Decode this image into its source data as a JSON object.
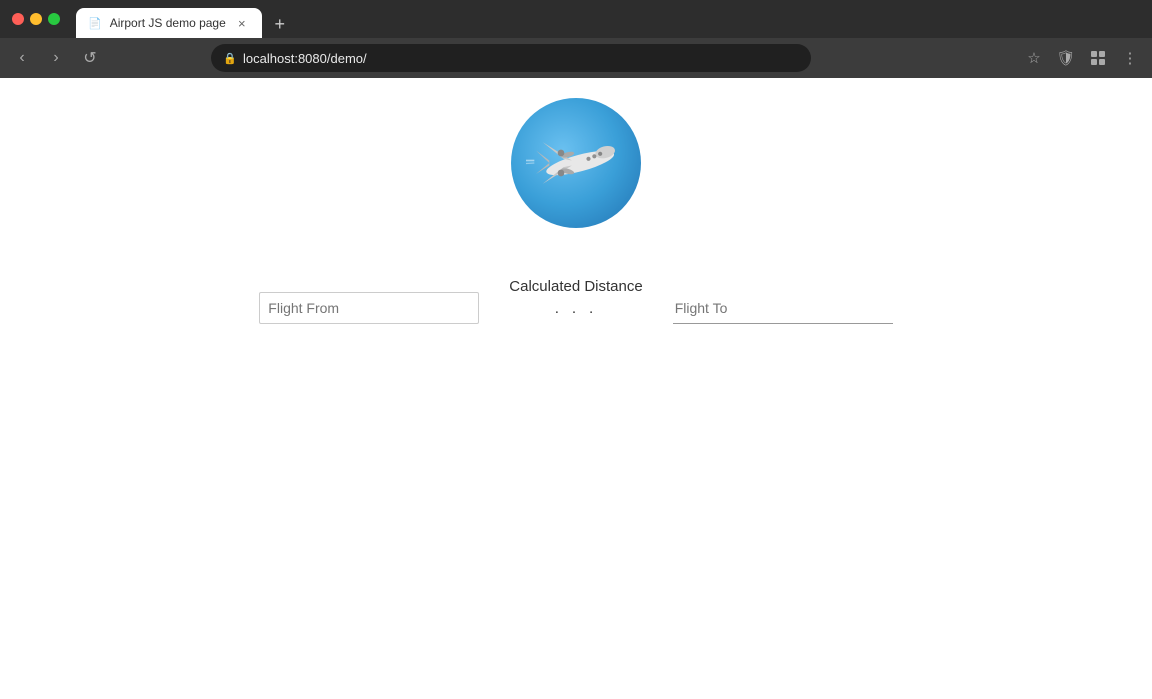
{
  "browser": {
    "tab_title": "Airport JS demo page",
    "url": "localhost:8080/demo/",
    "tab_close_icon": "×",
    "new_tab_icon": "+",
    "back_icon": "‹",
    "forward_icon": "›",
    "reload_icon": "↺",
    "star_icon": "☆",
    "shield_icon": "🛡",
    "extensions_icon": "⊞",
    "menu_icon": "⋮"
  },
  "page": {
    "flight_from_label": "Flight From",
    "flight_from_placeholder": "Flight From",
    "flight_to_label": "Flight To",
    "flight_to_placeholder": "Flight To",
    "calculated_distance_label": "Calculated Distance",
    "calculated_distance_value": "· · ·"
  }
}
